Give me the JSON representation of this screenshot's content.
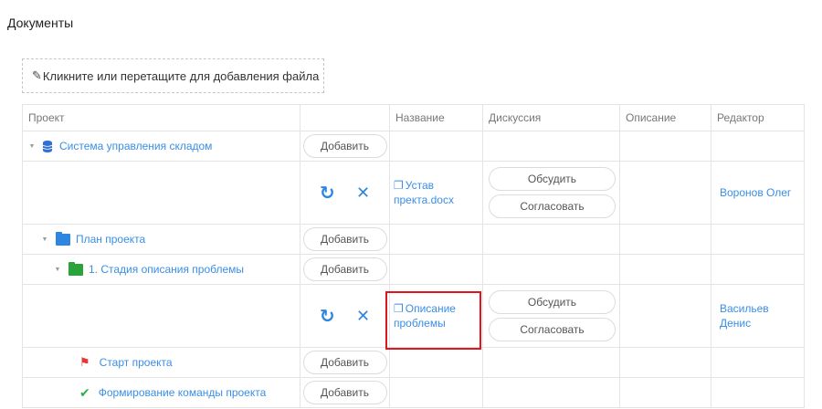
{
  "page": {
    "title": "Документы"
  },
  "upload": {
    "icon": "paperclip-icon",
    "label": "Кликните или перетащите для добавления файла"
  },
  "table": {
    "headers": [
      "Проект",
      "",
      "Название",
      "Дискуссия",
      "Описание",
      "Редактор"
    ],
    "rows": [
      {
        "name": "Система управления складом",
        "icon": "database-icon",
        "add": "Добавить"
      },
      {
        "file": "Устав\nпректа.docx",
        "discuss": "Обсудить",
        "approve": "Согласовать",
        "editor": "Воронов Олег"
      },
      {
        "name": "План проекта",
        "icon": "folder-icon",
        "add": "Добавить"
      },
      {
        "name": "1. Стадия описания проблемы",
        "icon": "folder-icon",
        "add": "Добавить"
      },
      {
        "file": "Описание\nпроблемы",
        "discuss": "Обсудить",
        "approve": "Согласовать",
        "editor": "Васильев\nДенис"
      },
      {
        "name": "Старт проекта",
        "icon": "flag-icon",
        "add": "Добавить"
      },
      {
        "name": "Формирование команды проекта",
        "icon": "check-icon",
        "add": "Добавить"
      }
    ]
  },
  "colors": {
    "link": "#3a8ee6",
    "db_icon": "#2f6fd6",
    "folder_blue": "#2f86e0",
    "folder_green": "#2aa33a",
    "flag": "#e53935",
    "check": "#2db24a",
    "highlight": "#e0151d"
  }
}
